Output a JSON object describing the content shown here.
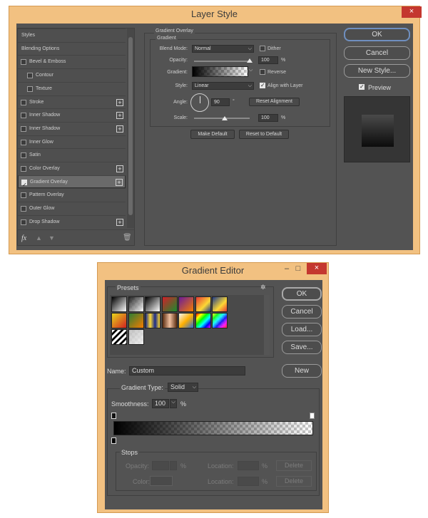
{
  "layer_style": {
    "title": "Layer Style",
    "close": "×",
    "list": {
      "items": [
        {
          "label": "Styles",
          "checkbox": false,
          "plus": false
        },
        {
          "label": "Blending Options",
          "checkbox": false,
          "plus": false
        },
        {
          "label": "Bevel & Emboss",
          "checkbox": true,
          "checked": false,
          "plus": false
        },
        {
          "label": "Contour",
          "checkbox": true,
          "checked": false,
          "plus": false,
          "indent": true
        },
        {
          "label": "Texture",
          "checkbox": true,
          "checked": false,
          "plus": false,
          "indent": true
        },
        {
          "label": "Stroke",
          "checkbox": true,
          "checked": false,
          "plus": true
        },
        {
          "label": "Inner Shadow",
          "checkbox": true,
          "checked": false,
          "plus": true
        },
        {
          "label": "Inner Shadow",
          "checkbox": true,
          "checked": false,
          "plus": true
        },
        {
          "label": "Inner Glow",
          "checkbox": true,
          "checked": false,
          "plus": false
        },
        {
          "label": "Satin",
          "checkbox": true,
          "checked": false,
          "plus": false
        },
        {
          "label": "Color Overlay",
          "checkbox": true,
          "checked": false,
          "plus": true
        },
        {
          "label": "Gradient Overlay",
          "checkbox": true,
          "checked": true,
          "plus": true,
          "selected": true
        },
        {
          "label": "Pattern Overlay",
          "checkbox": true,
          "checked": false,
          "plus": false
        },
        {
          "label": "Outer Glow",
          "checkbox": true,
          "checked": false,
          "plus": false
        },
        {
          "label": "Drop Shadow",
          "checkbox": true,
          "checked": false,
          "plus": true
        }
      ],
      "fx": "fx"
    },
    "section_title": "Gradient Overlay",
    "subsection_title": "Gradient",
    "blend_mode_label": "Blend Mode:",
    "blend_mode_value": "Normal",
    "dither_label": "Dither",
    "opacity_label": "Opacity:",
    "opacity_value": "100",
    "percent": "%",
    "gradient_label": "Gradient:",
    "reverse_label": "Reverse",
    "style_label": "Style:",
    "style_value": "Linear",
    "align_label": "Align with Layer",
    "angle_label": "Angle:",
    "angle_value": "90",
    "degree": "°",
    "reset_alignment": "Reset Alignment",
    "scale_label": "Scale:",
    "scale_value": "100",
    "make_default": "Make Default",
    "reset_default": "Reset to Default",
    "ok": "OK",
    "cancel": "Cancel",
    "new_style": "New Style...",
    "preview_label": "Preview",
    "opacity_level": 1.0,
    "scale_level": 0.55
  },
  "gradient_editor": {
    "title": "Gradient Editor",
    "minimize": "–",
    "maximize": "□",
    "close": "×",
    "presets_label": "Presets",
    "ok": "OK",
    "cancel": "Cancel",
    "load": "Load...",
    "save": "Save...",
    "name_label": "Name:",
    "name_value": "Custom",
    "new_button": "New",
    "gradient_type_label": "Gradient Type:",
    "gradient_type_value": "Solid",
    "smoothness_label": "Smoothness:",
    "smoothness_value": "100",
    "percent": "%",
    "stops_label": "Stops",
    "opacity_label": "Opacity:",
    "location_label": "Location:",
    "color_label": "Color:",
    "delete_label": "Delete",
    "presets": [
      {
        "css": "linear-gradient(135deg,#000 0%,#fff 100%)"
      },
      {
        "css": "linear-gradient(135deg,#000 0%,#fff 100%)",
        "checker": true
      },
      {
        "css": "linear-gradient(135deg,#000 0%,#fff 100%)"
      },
      {
        "css": "linear-gradient(135deg,#d1202a 0%,#1a8c2e 100%)"
      },
      {
        "css": "linear-gradient(135deg,#6a1b9a 0%,#f57c00 100%)"
      },
      {
        "css": "linear-gradient(135deg,#e53935 0%,#fdd835 60%,#1e3a8a 100%)"
      },
      {
        "css": "linear-gradient(135deg,#1e3a8a 0%,#fdd835 60%,#e53935 100%)"
      },
      {
        "css": "linear-gradient(135deg,#e7d61a 0%,#d22121 100%)"
      },
      {
        "css": "linear-gradient(135deg,#2e7d32 0%,#f57c00 100%)"
      },
      {
        "css": "linear-gradient(90deg,#1a2a8a,#fdd835,#1a2a8a,#fdd835)"
      },
      {
        "css": "linear-gradient(90deg,#5a2c10,#f0c0a0,#5a2c10)"
      },
      {
        "css": "linear-gradient(135deg,#f7f7f7,#ffb000,#2a6bd8)"
      },
      {
        "css": "linear-gradient(135deg,#f00,#ff0,#0f0,#0ff,#00f,#f0f)"
      },
      {
        "css": "linear-gradient(135deg,#ff0,#0f0,#0ff,#00f,#f0f,#f00)",
        "checker": true
      },
      {
        "css": "repeating-linear-gradient(135deg,#fff 0 3px,#000 3px 6px)"
      },
      {
        "css": "linear-gradient(135deg,#bbb,#eee)",
        "checker": true
      }
    ]
  }
}
